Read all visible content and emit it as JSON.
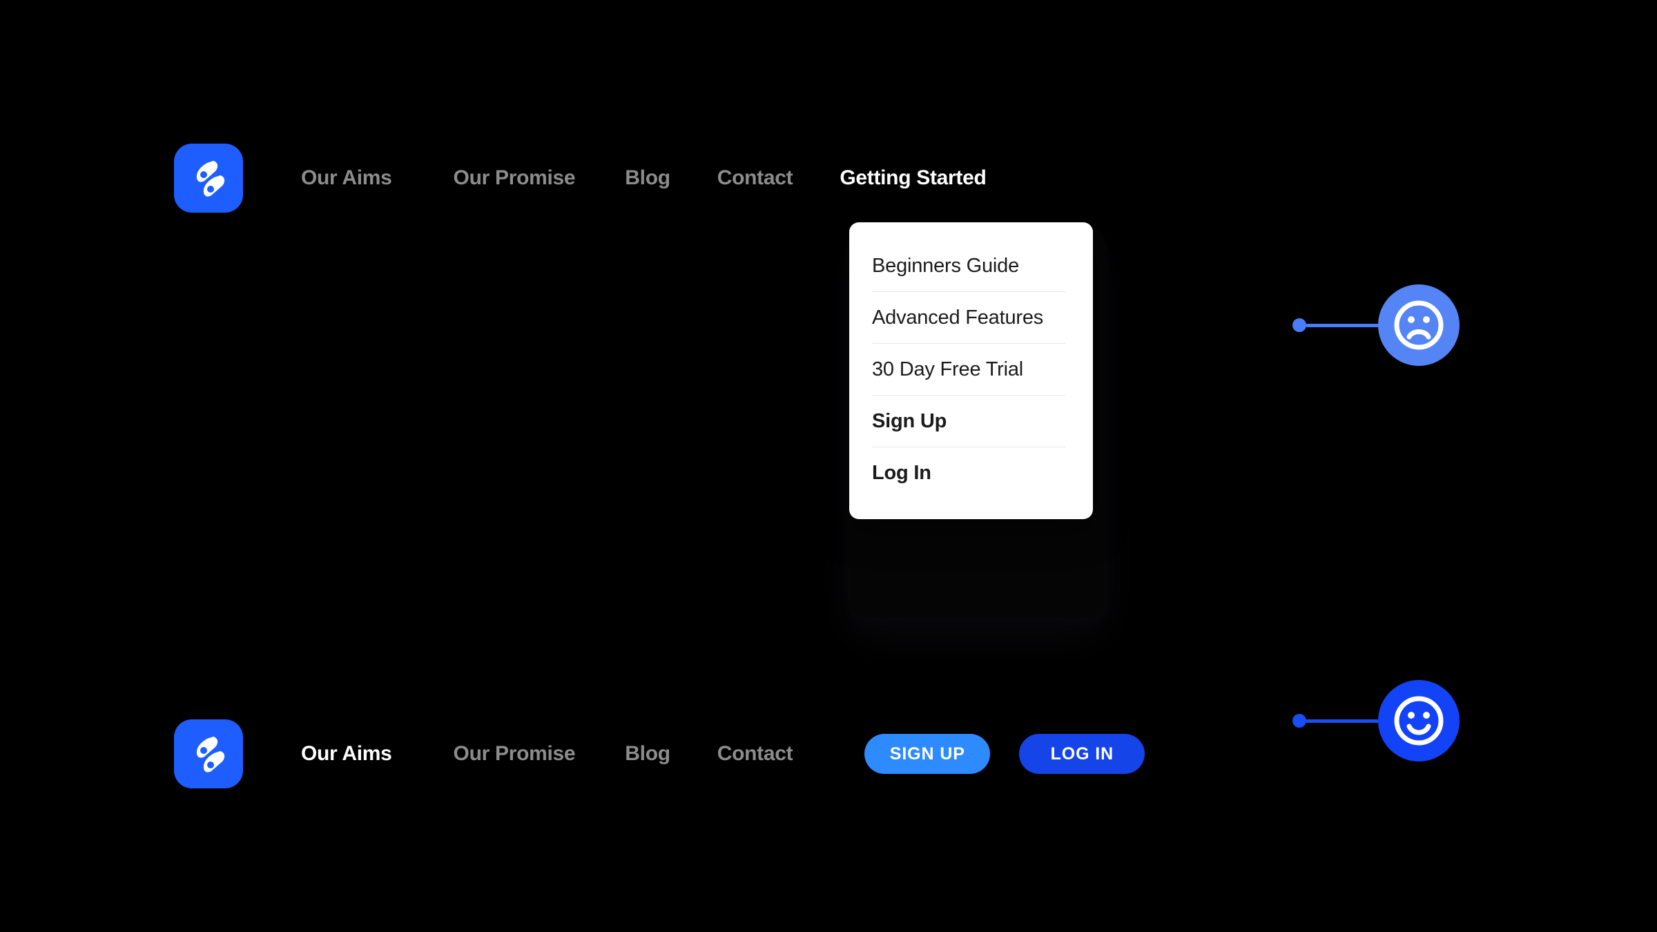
{
  "page": {
    "background_color": "#000000",
    "brand_color": "#1E5EFF"
  },
  "brand": {
    "logo_icon": "brand-leaf-logo-icon",
    "logo_color": "#1E5EFF"
  },
  "top_nav": {
    "items": [
      {
        "label": "Our Aims",
        "active": false
      },
      {
        "label": "Our Promise",
        "active": false
      },
      {
        "label": "Blog",
        "active": false
      },
      {
        "label": "Contact",
        "active": false
      },
      {
        "label": "Getting Started",
        "active": true
      }
    ]
  },
  "dropdown": {
    "open_for": "Getting Started",
    "items": [
      {
        "label": "Beginners Guide",
        "bold": false
      },
      {
        "label": "Advanced Features",
        "bold": false
      },
      {
        "label": "30 Day Free Trial",
        "bold": false
      },
      {
        "label": "Sign Up",
        "bold": true
      },
      {
        "label": "Log In",
        "bold": true
      }
    ],
    "background_color": "#ffffff",
    "text_color": "#1b1b1b"
  },
  "bottom_nav": {
    "items": [
      {
        "label": "Our Aims",
        "active": true
      },
      {
        "label": "Our Promise",
        "active": false
      },
      {
        "label": "Blog",
        "active": false
      },
      {
        "label": "Contact",
        "active": false
      }
    ],
    "buttons": [
      {
        "label": "SIGN UP",
        "color": "#2e8bff"
      },
      {
        "label": "LOG IN",
        "color": "#1544e8"
      }
    ]
  },
  "mood_indicators": [
    {
      "icon": "frowning-face-icon",
      "state": "sad",
      "circle_color": "#5585f5",
      "connector_color": "#4a7dfb"
    },
    {
      "icon": "smiling-face-icon",
      "state": "happy",
      "circle_color": "#1243f7",
      "connector_color": "#1b4cf5"
    }
  ]
}
